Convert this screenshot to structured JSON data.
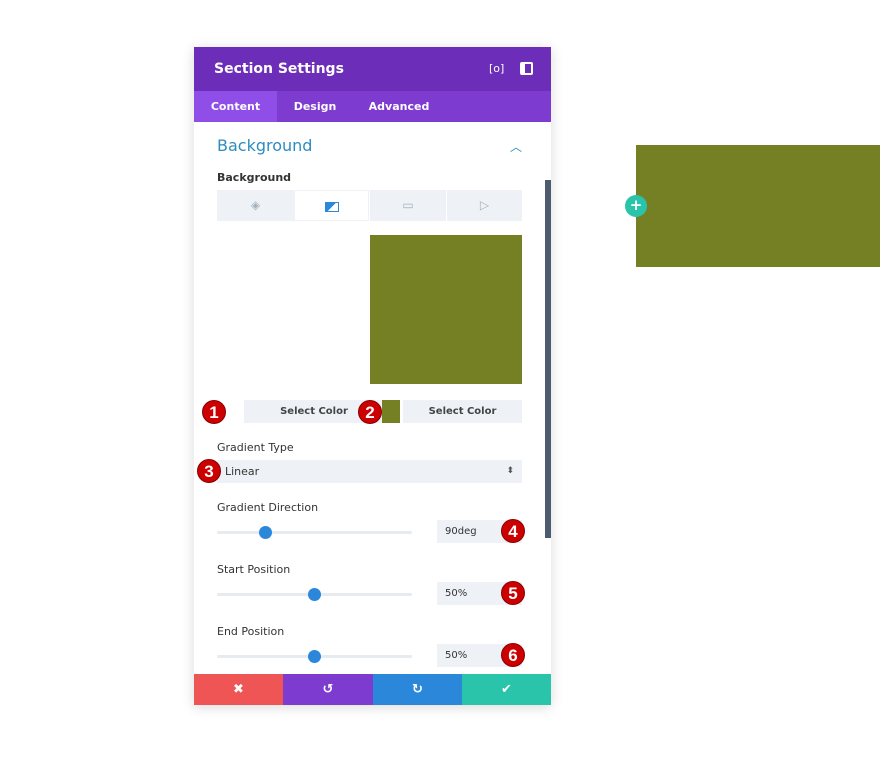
{
  "panel": {
    "title": "Section Settings",
    "header_icons": [
      "fullscreen-icon",
      "sidebar-toggle-icon"
    ],
    "tabs": [
      {
        "label": "Content",
        "active": true
      },
      {
        "label": "Design",
        "active": false
      },
      {
        "label": "Advanced",
        "active": false
      }
    ],
    "section_title": "Background",
    "background_label": "Background",
    "bg_tabs": [
      "paint-bucket-icon",
      "gradient-icon",
      "image-icon",
      "video-icon"
    ],
    "active_bg_tab": 1,
    "gradient_color": "#748023",
    "select_color_1": "Select Color",
    "select_color_2": "Select Color",
    "gradient_type_label": "Gradient Type",
    "gradient_type_value": "Linear",
    "direction_label": "Gradient Direction",
    "direction_value": "90deg",
    "direction_fraction": 0.25,
    "start_label": "Start Position",
    "start_value": "50%",
    "start_fraction": 0.5,
    "end_label": "End Position",
    "end_value": "50%",
    "end_fraction": 0.5,
    "footer": {
      "cancel": "✖",
      "undo": "↺",
      "redo": "↻",
      "save": "✔"
    }
  },
  "badges": [
    "1",
    "2",
    "3",
    "4",
    "5",
    "6"
  ],
  "colors": {
    "header": "#6c2eb9",
    "tabs": "#7e3bd0",
    "accent": "#2b87da",
    "cancel": "#ef5555",
    "undo": "#7e3bd0",
    "redo": "#2b87da",
    "save": "#29c4a9",
    "preview": "#748023"
  },
  "canvas": {
    "add_button": "+"
  }
}
